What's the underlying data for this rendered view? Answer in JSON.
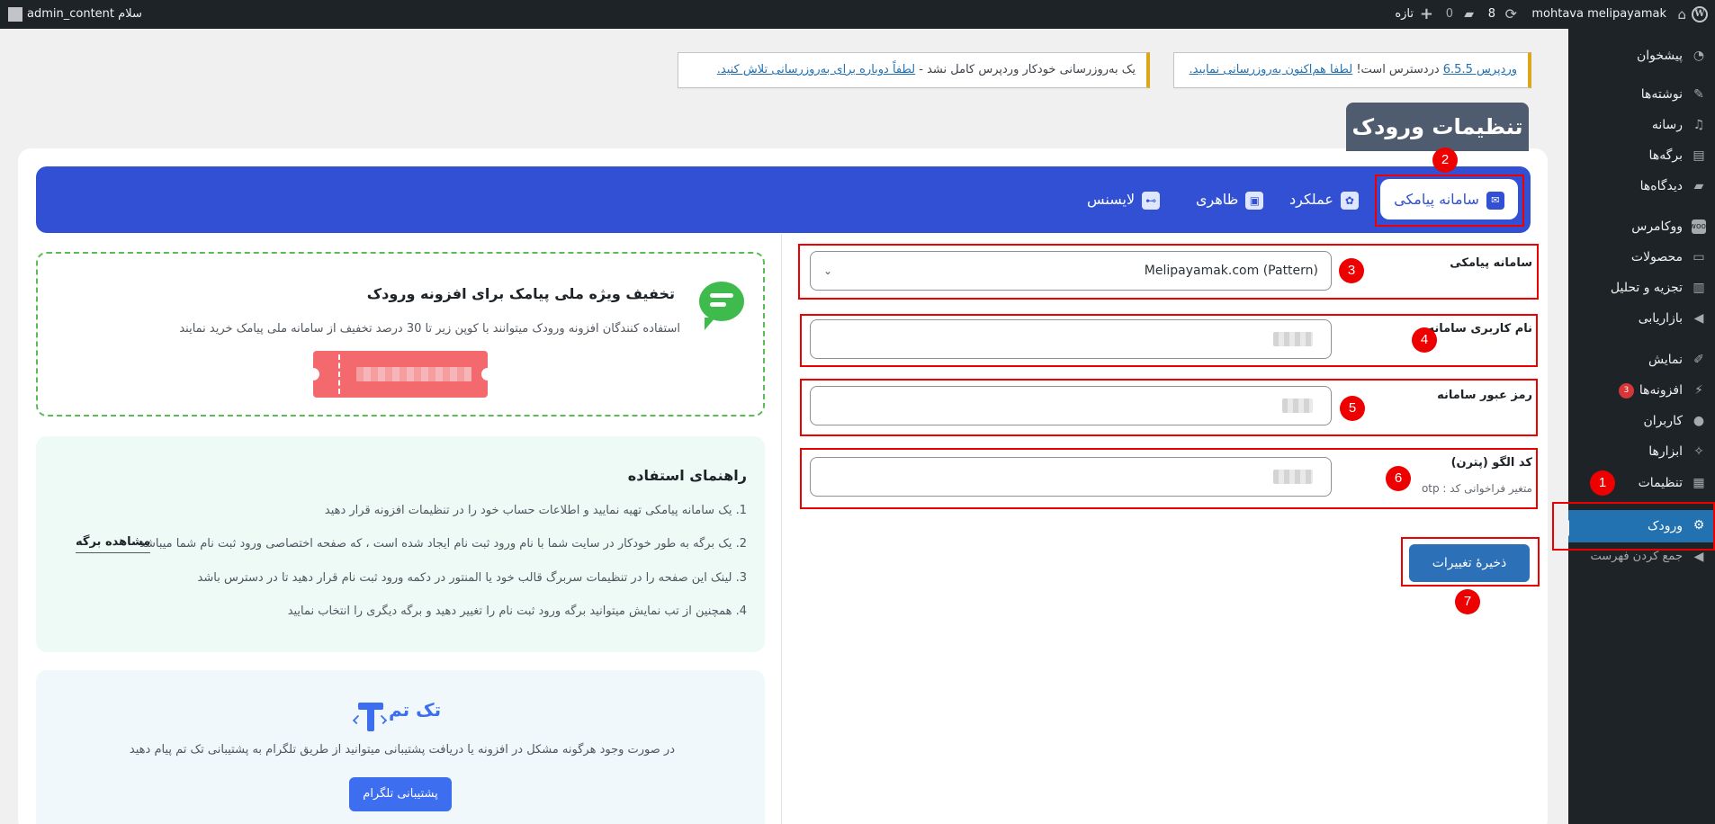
{
  "adminbar": {
    "site_name": "mohtava melipayamak",
    "updates_count": "8",
    "comments_count": "0",
    "new_label": "تازه",
    "greeting": "سلام admin_content"
  },
  "sidebar": {
    "items": [
      {
        "label": "پیشخوان",
        "icon": "dashboard-icon"
      },
      {
        "label": "نوشته‌ها",
        "icon": "pin-icon"
      },
      {
        "label": "رسانه",
        "icon": "media-icon"
      },
      {
        "label": "برگه‌ها",
        "icon": "pages-icon"
      },
      {
        "label": "دیدگاه‌ها",
        "icon": "comment-icon"
      },
      {
        "label": "ووکامرس",
        "icon": "woo-icon"
      },
      {
        "label": "محصولات",
        "icon": "archive-icon"
      },
      {
        "label": "تجزیه و تحلیل",
        "icon": "chart-icon"
      },
      {
        "label": "بازاریابی",
        "icon": "megaphone-icon"
      },
      {
        "label": "نمایش",
        "icon": "brush-icon"
      },
      {
        "label": "افزونه‌ها",
        "icon": "plugin-icon",
        "badge": "3"
      },
      {
        "label": "کاربران",
        "icon": "user-icon"
      },
      {
        "label": "ابزارها",
        "icon": "wrench-icon"
      },
      {
        "label": "تنظیمات",
        "icon": "settings-icon"
      },
      {
        "label": "ورودک",
        "icon": "gear-icon"
      },
      {
        "label": "جمع کردن فهرست",
        "icon": "collapse-icon"
      }
    ]
  },
  "notices": {
    "update_core": {
      "link1": "وردپرس 6.5.5",
      "text": " دردسترس است! ",
      "link2": "لطفا هم‌اکنون به‌روزرسانی نمایید."
    },
    "auto_update": {
      "text": "یک به‌روزرسانی خودکار وردپرس کامل نشد - ",
      "link": "لطفاً دوباره برای به‌روزرسانی تلاش کنید."
    }
  },
  "page_title": "تنظیمات ورودک",
  "tabs": [
    {
      "label": "سامانه پیامکی",
      "icon": "envelope-icon"
    },
    {
      "label": "عملکرد",
      "icon": "cog-icon"
    },
    {
      "label": "ظاهری",
      "icon": "image-icon"
    },
    {
      "label": "لایسنس",
      "icon": "key-icon"
    }
  ],
  "form": {
    "provider_label": "سامانه پیامکی",
    "provider_value": "Melipayamak.com (Pattern)",
    "username_label": "نام کاربری سامانه",
    "password_label": "رمز عبور سامانه",
    "pattern_label": "کد الگو (پترن)",
    "pattern_hint": "متغیر فراخوانی کد : otp",
    "save_label": "ذخیرهٔ تغییرات"
  },
  "promo": {
    "title": "تخفیف ویژه ملی پیامک برای افزونه ورودک",
    "desc": "استفاده کنندگان افزونه ورودک میتوانند با کوپن زیر تا 30 درصد تخفیف از سامانه ملی پیامک خرید نمایند"
  },
  "guide": {
    "title": "راهنمای استفاده",
    "items": [
      "1. یک سامانه پیامکی تهیه نمایید و اطلاعات حساب خود را در تنظیمات افزونه قرار دهید",
      "2. یک برگه به طور خودکار در سایت شما با نام ورود ثبت نام ایجاد شده است ، که صفحه اختصاصی ورود ثبت نام شما میباشد",
      "3. لینک این صفحه را در تنظیمات سربرگ قالب خود یا المنتور در دکمه ورود ثبت نام قرار دهید تا در دسترس باشد",
      "4. همچنین از تب نمایش میتوانید برگه ورود ثبت نام را تغییر دهید و برگه دیگری را انتخاب نمایید"
    ],
    "view_page_label": "مشاهده برگه"
  },
  "support": {
    "brand": "تک تم",
    "desc": "در صورت وجود هرگونه مشکل در افزونه یا دریافت پشتیبانی میتوانید از طریق تلگرام به پشتیبانی تک تم پیام دهید",
    "button_label": "پشتیبانی تلگرام"
  },
  "markers": [
    "1",
    "2",
    "3",
    "4",
    "5",
    "6",
    "7"
  ],
  "colors": {
    "accent": "#3150d4",
    "wp_blue": "#2271b1",
    "annotation_red": "#e00000",
    "promo_green": "#3fbb4d"
  }
}
